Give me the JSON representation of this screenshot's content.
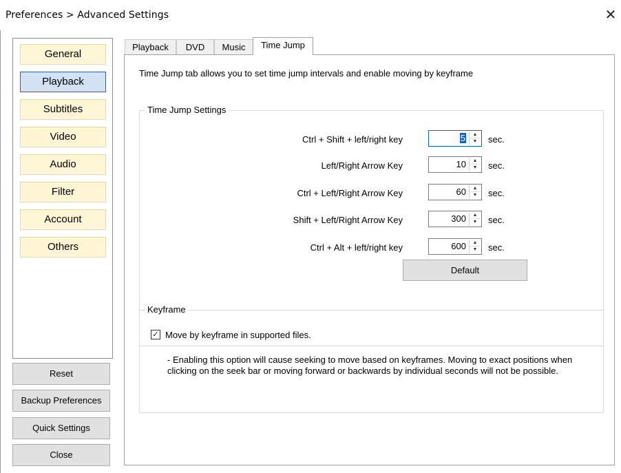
{
  "window": {
    "title": "Preferences > Advanced Settings",
    "close_glyph": "✕"
  },
  "sidebar": {
    "items": [
      {
        "label": "General",
        "active": false
      },
      {
        "label": "Playback",
        "active": true
      },
      {
        "label": "Subtitles",
        "active": false
      },
      {
        "label": "Video",
        "active": false
      },
      {
        "label": "Audio",
        "active": false
      },
      {
        "label": "Filter",
        "active": false
      },
      {
        "label": "Account",
        "active": false
      },
      {
        "label": "Others",
        "active": false
      }
    ]
  },
  "actions": {
    "reset": "Reset",
    "backup": "Backup Preferences",
    "quick": "Quick Settings",
    "close": "Close"
  },
  "tabs": [
    {
      "label": "Playback",
      "active": false
    },
    {
      "label": "DVD",
      "active": false
    },
    {
      "label": "Music",
      "active": false
    },
    {
      "label": "Time Jump",
      "active": true
    }
  ],
  "main": {
    "description": "Time Jump tab allows you to set time jump intervals and enable moving by keyframe",
    "time_jump": {
      "group_label": "Time Jump Settings",
      "rows": [
        {
          "label": "Ctrl + Shift + left/right key",
          "value": "5",
          "unit": "sec."
        },
        {
          "label": "Left/Right Arrow Key",
          "value": "10",
          "unit": "sec."
        },
        {
          "label": "Ctrl + Left/Right Arrow Key",
          "value": "60",
          "unit": "sec."
        },
        {
          "label": "Shift + Left/Right Arrow Key",
          "value": "300",
          "unit": "sec."
        },
        {
          "label": "Ctrl + Alt + left/right key",
          "value": "600",
          "unit": "sec."
        }
      ],
      "default_button": "Default"
    },
    "keyframe": {
      "group_label": "Keyframe",
      "checkbox_label": "Move by keyframe in supported files.",
      "checked": true,
      "check_glyph": "✓",
      "note": "- Enabling this option will cause seeking to move based on keyframes. Moving to exact positions when clicking on the seek bar or moving forward or backwards by individual seconds will not be possible."
    }
  },
  "icons": {
    "spin_up": "▲",
    "spin_down": "▼"
  },
  "colors": {
    "category_bg": "#fff6d6",
    "category_active_bg": "#d3e1f5",
    "focus_blue": "#0a64d8"
  }
}
